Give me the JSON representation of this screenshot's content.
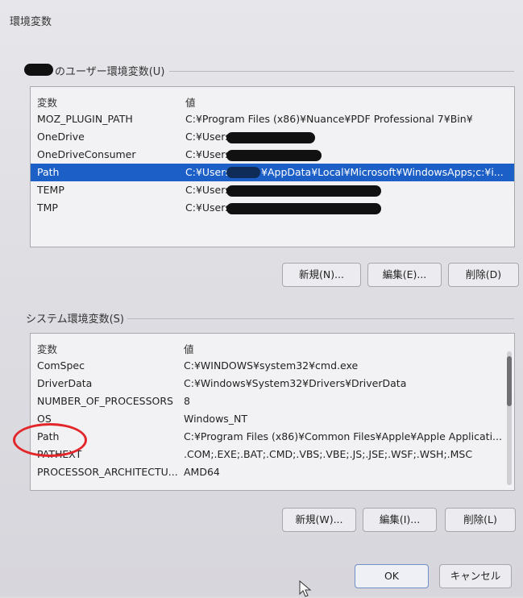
{
  "window": {
    "title": "環境変数"
  },
  "user_vars": {
    "group_label": "のユーザー環境変数(U)",
    "col_name": "変数",
    "col_value": "値",
    "rows": [
      {
        "name": "MOZ_PLUGIN_PATH",
        "value": "C:¥Program Files (x86)¥Nuance¥PDF Professional 7¥Bin¥"
      },
      {
        "name": "OneDrive",
        "value": "C:¥Users"
      },
      {
        "name": "OneDriveConsumer",
        "value": "C:¥Users"
      },
      {
        "name": "Path",
        "value": "C:¥Users",
        "value_tail": "¥AppData¥Local¥Microsoft¥WindowsApps;c:¥i..."
      },
      {
        "name": "TEMP",
        "value": "C:¥Users"
      },
      {
        "name": "TMP",
        "value": "C:¥Users"
      }
    ],
    "buttons": {
      "new": "新規(N)...",
      "edit": "編集(E)...",
      "delete": "削除(D)"
    }
  },
  "system_vars": {
    "group_label": "システム環境変数(S)",
    "col_name": "変数",
    "col_value": "値",
    "rows": [
      {
        "name": "ComSpec",
        "value": "C:¥WINDOWS¥system32¥cmd.exe"
      },
      {
        "name": "DriverData",
        "value": "C:¥Windows¥System32¥Drivers¥DriverData"
      },
      {
        "name": "NUMBER_OF_PROCESSORS",
        "value": "8"
      },
      {
        "name": "OS",
        "value": "Windows_NT"
      },
      {
        "name": "Path",
        "value": "C:¥Program Files (x86)¥Common Files¥Apple¥Apple Applicati..."
      },
      {
        "name": "PATHEXT",
        "value": ".COM;.EXE;.BAT;.CMD;.VBS;.VBE;.JS;.JSE;.WSF;.WSH;.MSC"
      },
      {
        "name": "PROCESSOR_ARCHITECTU...",
        "value": "AMD64"
      }
    ],
    "buttons": {
      "new": "新規(W)...",
      "edit": "編集(I)...",
      "delete": "削除(L)"
    }
  },
  "footer": {
    "ok": "OK",
    "cancel": "キャンセル"
  },
  "colors": {
    "selection": "#1c5fc7",
    "annotation_circle": "#e2262a",
    "redaction": "#111111"
  },
  "icons": {
    "cursor": "mouse-pointer-icon"
  }
}
